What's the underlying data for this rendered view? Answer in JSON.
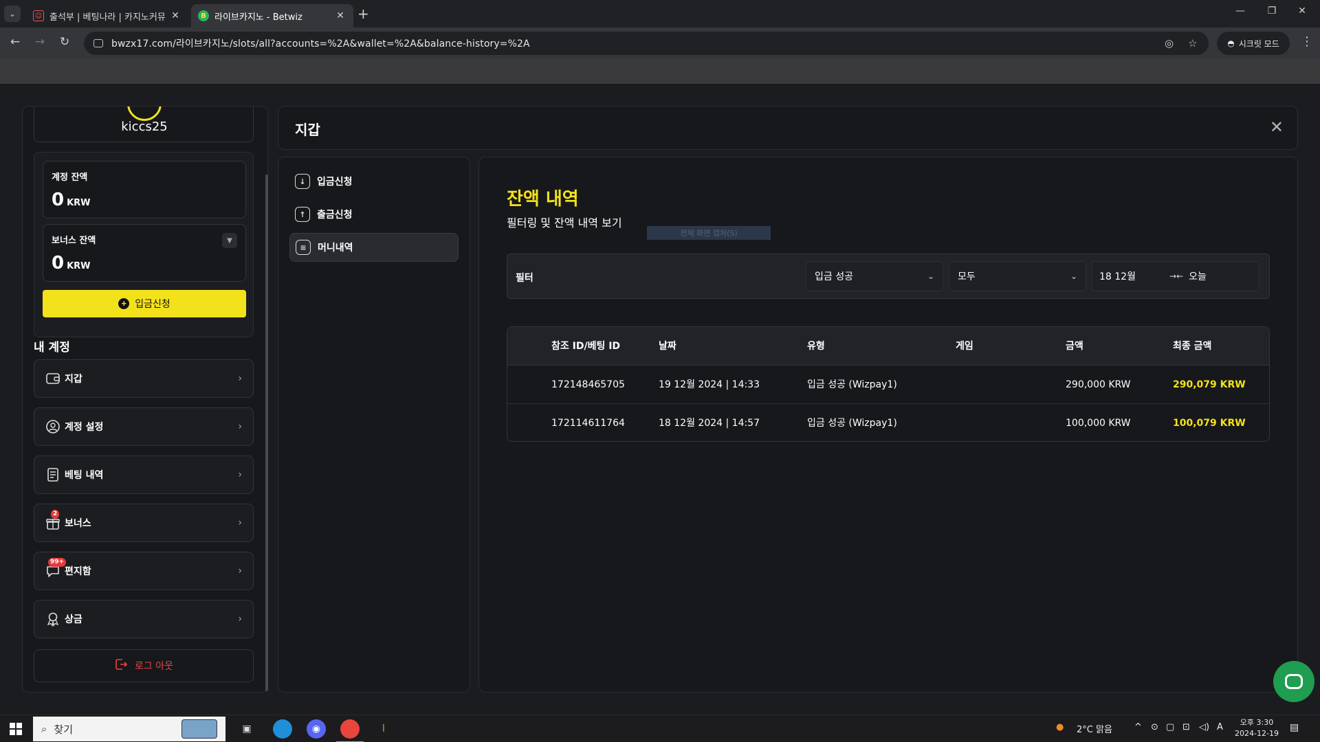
{
  "browser": {
    "tabs": [
      {
        "label": "출석부 | 베팅나라 | 카지노커뮤",
        "close": "✕"
      },
      {
        "label": "라이브카지노 - Betwiz",
        "close": "✕"
      }
    ],
    "new_tab": "+",
    "url": "bwzx17.com/라이브카지노/slots/all?accounts=%2A&wallet=%2A&balance-history=%2A",
    "incognito_label": "시크릿 모드"
  },
  "sidebar": {
    "username": "kiccs25",
    "account_balance": {
      "label": "계정 잔액",
      "value": "0",
      "currency": "KRW"
    },
    "bonus_balance": {
      "label": "보너스 잔액",
      "value": "0",
      "currency": "KRW"
    },
    "deposit_button": "입금신청",
    "section_title": "내 계정",
    "menu": [
      {
        "label": "지갑",
        "icon": "wallet-icon"
      },
      {
        "label": "계정 설정",
        "icon": "user-settings-icon"
      },
      {
        "label": "베팅 내역",
        "icon": "betting-history-icon"
      },
      {
        "label": "보너스",
        "icon": "gift-icon",
        "badge": "2"
      },
      {
        "label": "편지함",
        "icon": "inbox-icon",
        "badge": "99+"
      },
      {
        "label": "상금",
        "icon": "award-icon"
      }
    ],
    "logout": "로그 아웃"
  },
  "header": {
    "title": "지갑"
  },
  "submenu": [
    {
      "label": "입금신청",
      "icon": "download-icon"
    },
    {
      "label": "출금신청",
      "icon": "upload-icon"
    },
    {
      "label": "머니내역",
      "icon": "document-icon",
      "active": true
    }
  ],
  "content": {
    "title": "잔액 내역",
    "subtitle": "필터링 및 잔액 내역 보기",
    "ghost_tooltip": "전체 화면 캡처(S)",
    "filter": {
      "label": "필터",
      "type_select": "입금 성공",
      "status_select": "모두",
      "date_from": "18 12월",
      "date_to": "오늘"
    },
    "table": {
      "headers": [
        "참조 ID/베팅 ID",
        "날짜",
        "유형",
        "게임",
        "금액",
        "최종 금액"
      ],
      "rows": [
        [
          "172148465705",
          "19 12월 2024 | 14:33",
          "입금 성공 (Wizpay1)",
          "",
          "290,000 KRW",
          "290,079 KRW"
        ],
        [
          "172114611764",
          "18 12월 2024 | 14:57",
          "입금 성공 (Wizpay1)",
          "",
          "100,000 KRW",
          "100,079 KRW"
        ]
      ]
    }
  },
  "taskbar": {
    "search_placeholder": "찾기",
    "weather": "2°C  맑음",
    "ime": "A",
    "time": "오후 3:30",
    "date": "2024-12-19"
  },
  "colors": {
    "accent": "#f3e21b",
    "danger": "#e84545",
    "chat": "#1f9d50"
  }
}
